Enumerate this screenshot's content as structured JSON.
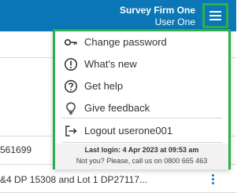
{
  "header": {
    "firm_name": "Survey Firm One",
    "user_name": "User One",
    "brand_color": "#0b77b6",
    "highlight_color": "#2eae4e",
    "menu_icon": "hamburger-menu-icon"
  },
  "background": {
    "rows": [
      {
        "text": "561699"
      },
      {
        "text": "&4 DP 15308 and Lot 1 DP27117..."
      }
    ]
  },
  "menu": {
    "items": [
      {
        "label": "Change password",
        "icon": "key-icon"
      },
      {
        "label": "What's new",
        "icon": "exclamation-circle-icon"
      },
      {
        "label": "Get help",
        "icon": "question-circle-icon"
      },
      {
        "label": "Give feedback",
        "icon": "lightbulb-icon"
      },
      {
        "label": "Logout userone001",
        "icon": "logout-icon"
      }
    ],
    "last_login": "Last login: 4 Apr 2023 at 09:53 am",
    "not_you": "Not you? Please, call us on 0800 665 463"
  }
}
